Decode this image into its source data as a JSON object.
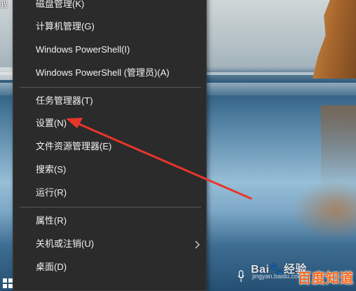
{
  "menu": {
    "items": [
      {
        "label": "磁盘管理(K)"
      },
      {
        "label": "计算机管理(G)"
      },
      {
        "label": "Windows PowerShell(I)"
      },
      {
        "label": "Windows PowerShell (管理员)(A)"
      },
      {
        "label": "任务管理器(T)"
      },
      {
        "label": "设置(N)"
      },
      {
        "label": "文件资源管理器(E)"
      },
      {
        "label": "搜索(S)"
      },
      {
        "label": "运行(R)"
      },
      {
        "label": "属性(R)"
      },
      {
        "label": "关机或注销(U)"
      },
      {
        "label": "桌面(D)"
      }
    ]
  },
  "annotation": {
    "color": "#e8362b",
    "points_to": "设置(N)"
  },
  "desktop": {
    "left_label": "我"
  },
  "watermark": {
    "brand": "Bai",
    "brand_suffix": "经验",
    "sub": "jingyan.baidu.com",
    "zhidao": "百度知道"
  }
}
